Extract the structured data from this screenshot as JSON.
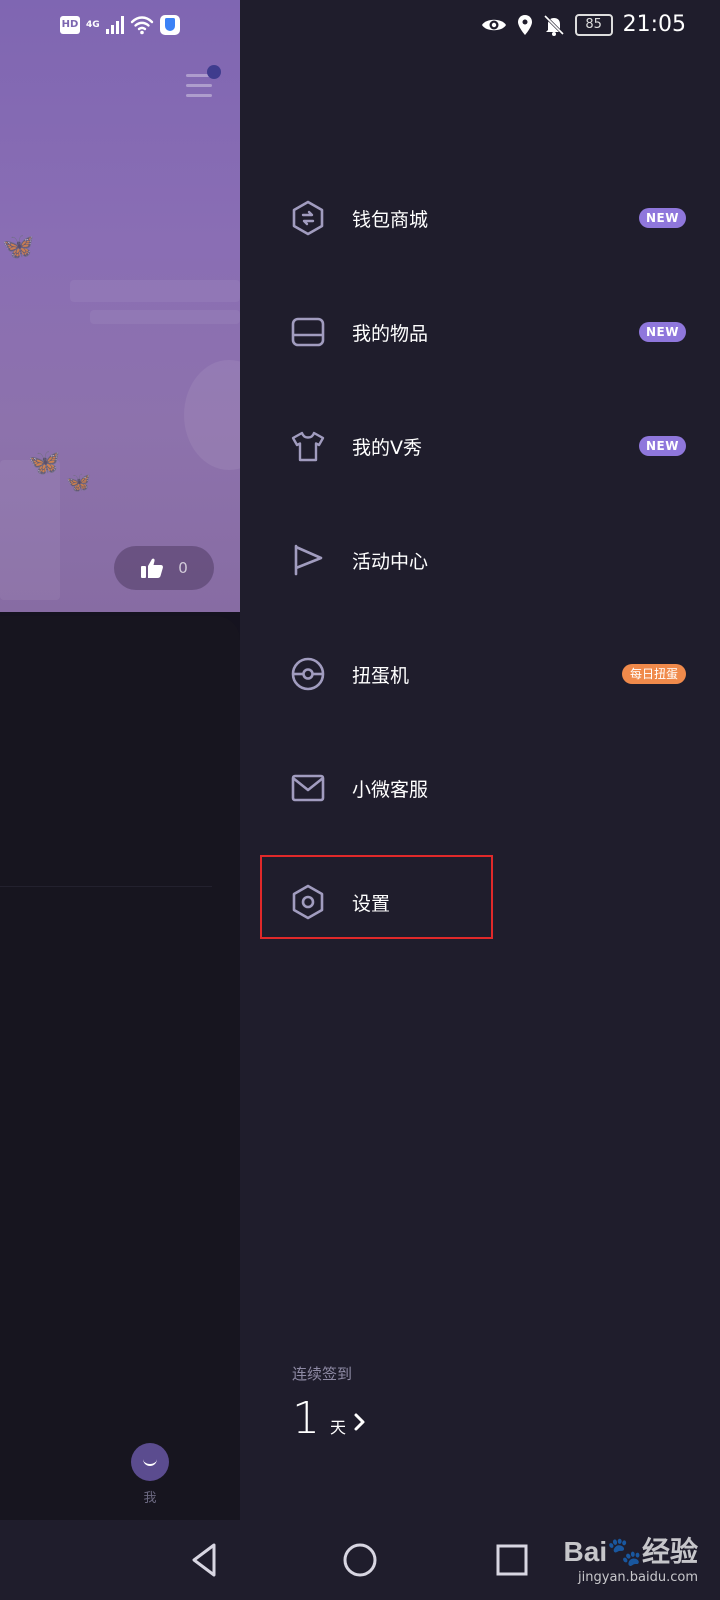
{
  "status_bar": {
    "left_icons": [
      "hd-icon",
      "4g-signal-icon",
      "signal-bars-icon",
      "wifi-icon",
      "shield-app-icon"
    ],
    "network_label": "4G",
    "hd_label": "HD",
    "right_icons": [
      "eye-icon",
      "location-icon",
      "mute-icon",
      "battery-icon"
    ],
    "battery_level": "85",
    "time": "21:05"
  },
  "background_page": {
    "like_count": "0",
    "bottom_tab_label": "我"
  },
  "drawer": {
    "items": [
      {
        "label": "钱包商城",
        "icon": "wallet-exchange-icon",
        "badge": "NEW",
        "badge_type": "new"
      },
      {
        "label": "我的物品",
        "icon": "inventory-box-icon",
        "badge": "NEW",
        "badge_type": "new"
      },
      {
        "label": "我的V秀",
        "icon": "tshirt-icon",
        "badge": "NEW",
        "badge_type": "new"
      },
      {
        "label": "活动中心",
        "icon": "flag-icon",
        "badge": "",
        "badge_type": ""
      },
      {
        "label": "扭蛋机",
        "icon": "capsule-ball-icon",
        "badge": "每日扭蛋",
        "badge_type": "daily"
      },
      {
        "label": "小微客服",
        "icon": "mail-icon",
        "badge": "",
        "badge_type": ""
      },
      {
        "label": "设置",
        "icon": "settings-hexagon-icon",
        "badge": "",
        "badge_type": ""
      }
    ],
    "checkin": {
      "label": "连续签到",
      "days": "1",
      "unit": "天"
    }
  },
  "colors": {
    "drawer_bg": "#1f1d2c",
    "badge_new": "#8f77dc",
    "badge_daily": "#f08a4b",
    "icon_stroke": "#a19cbf",
    "highlight": "#e0292a"
  },
  "watermark": {
    "brand": "Bai",
    "brand_suffix": "经验",
    "url": "jingyan.baidu.com"
  }
}
